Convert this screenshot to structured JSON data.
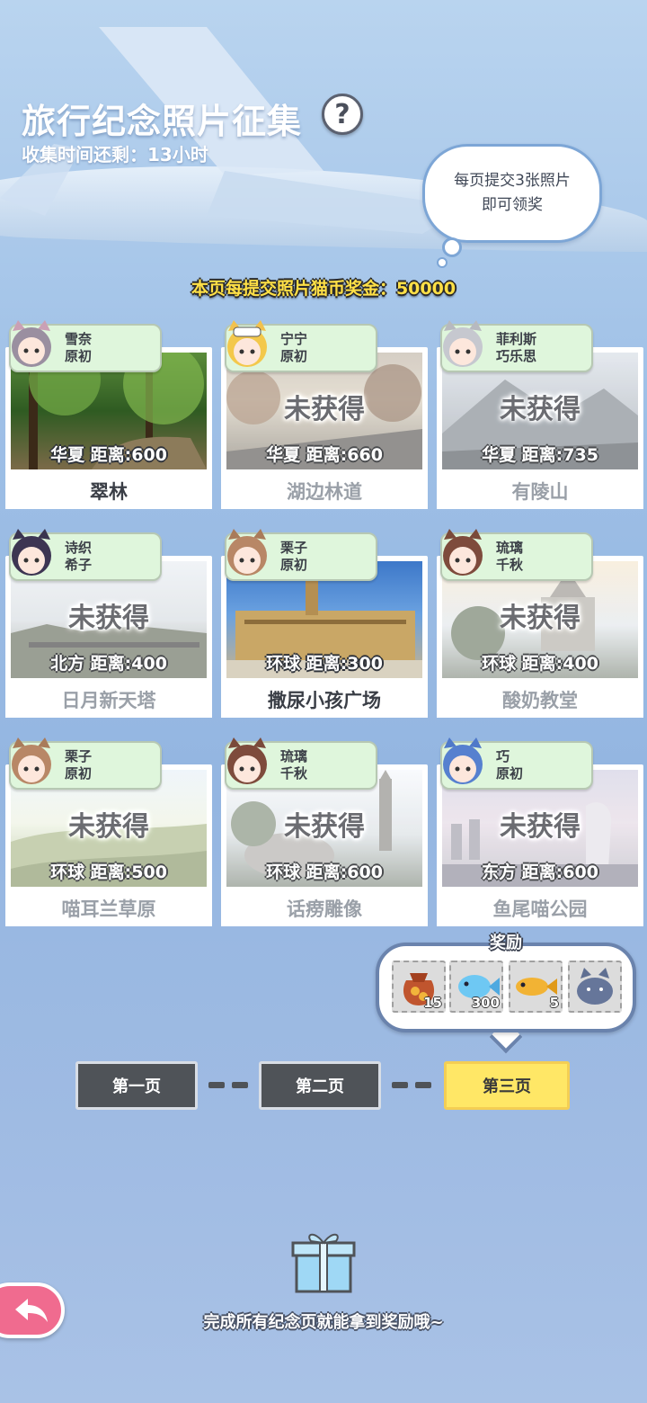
{
  "header": {
    "title": "旅行纪念照片征集",
    "help_icon": "question-mark-icon",
    "help_glyph": "?",
    "countdown": "收集时间还剩：13小时"
  },
  "bubble": {
    "line1": "每页提交3张照片",
    "line2": "即可领奖"
  },
  "bonus_text": "本页每提交照片猫币奖金：50000",
  "cards": [
    {
      "name1": "雪奈",
      "name2": "原初",
      "status": "",
      "distance": "华夏  距离:600",
      "label": "翠林"
    },
    {
      "name1": "宁宁",
      "name2": "原初",
      "status": "未获得",
      "distance": "华夏  距离:660",
      "label": "湖边林道"
    },
    {
      "name1": "菲利斯",
      "name2": "巧乐思",
      "status": "未获得",
      "distance": "华夏  距离:735",
      "label": "有陵山"
    },
    {
      "name1": "诗织",
      "name2": "希子",
      "status": "未获得",
      "distance": "北方  距离:400",
      "label": "日月新天塔"
    },
    {
      "name1": "栗子",
      "name2": "原初",
      "status": "",
      "distance": "环球  距离:300",
      "label": "撒尿小孩广场"
    },
    {
      "name1": "琉璃",
      "name2": "千秋",
      "status": "未获得",
      "distance": "环球  距离:400",
      "label": "酸奶教堂"
    },
    {
      "name1": "栗子",
      "name2": "原初",
      "status": "未获得",
      "distance": "环球  距离:500",
      "label": "喵耳兰草原"
    },
    {
      "name1": "琉璃",
      "name2": "千秋",
      "status": "未获得",
      "distance": "环球  距离:600",
      "label": "话痨雕像"
    },
    {
      "name1": "巧",
      "name2": "原初",
      "status": "未获得",
      "distance": "东方  距离:600",
      "label": "鱼尾喵公园"
    }
  ],
  "rewards": {
    "title": "奖励",
    "items": [
      {
        "icon": "coin-bag-icon",
        "qty": "15"
      },
      {
        "icon": "blue-fish-icon",
        "qty": "300"
      },
      {
        "icon": "gold-fish-icon",
        "qty": "5"
      },
      {
        "icon": "cat-plush-icon",
        "qty": ""
      }
    ]
  },
  "pages": {
    "p1": "第一页",
    "p2": "第二页",
    "p3": "第三页",
    "active": "第三页"
  },
  "footer": {
    "hint": "完成所有纪念页就能拿到奖励哦~",
    "gift_icon": "gift-box-icon",
    "back_icon": "back-arrow-icon"
  },
  "colors": {
    "accent_yellow": "#ffe766",
    "bonus_yellow": "#ffe046",
    "tag_green": "#dff6dc",
    "back_pink": "#f06b8f"
  }
}
